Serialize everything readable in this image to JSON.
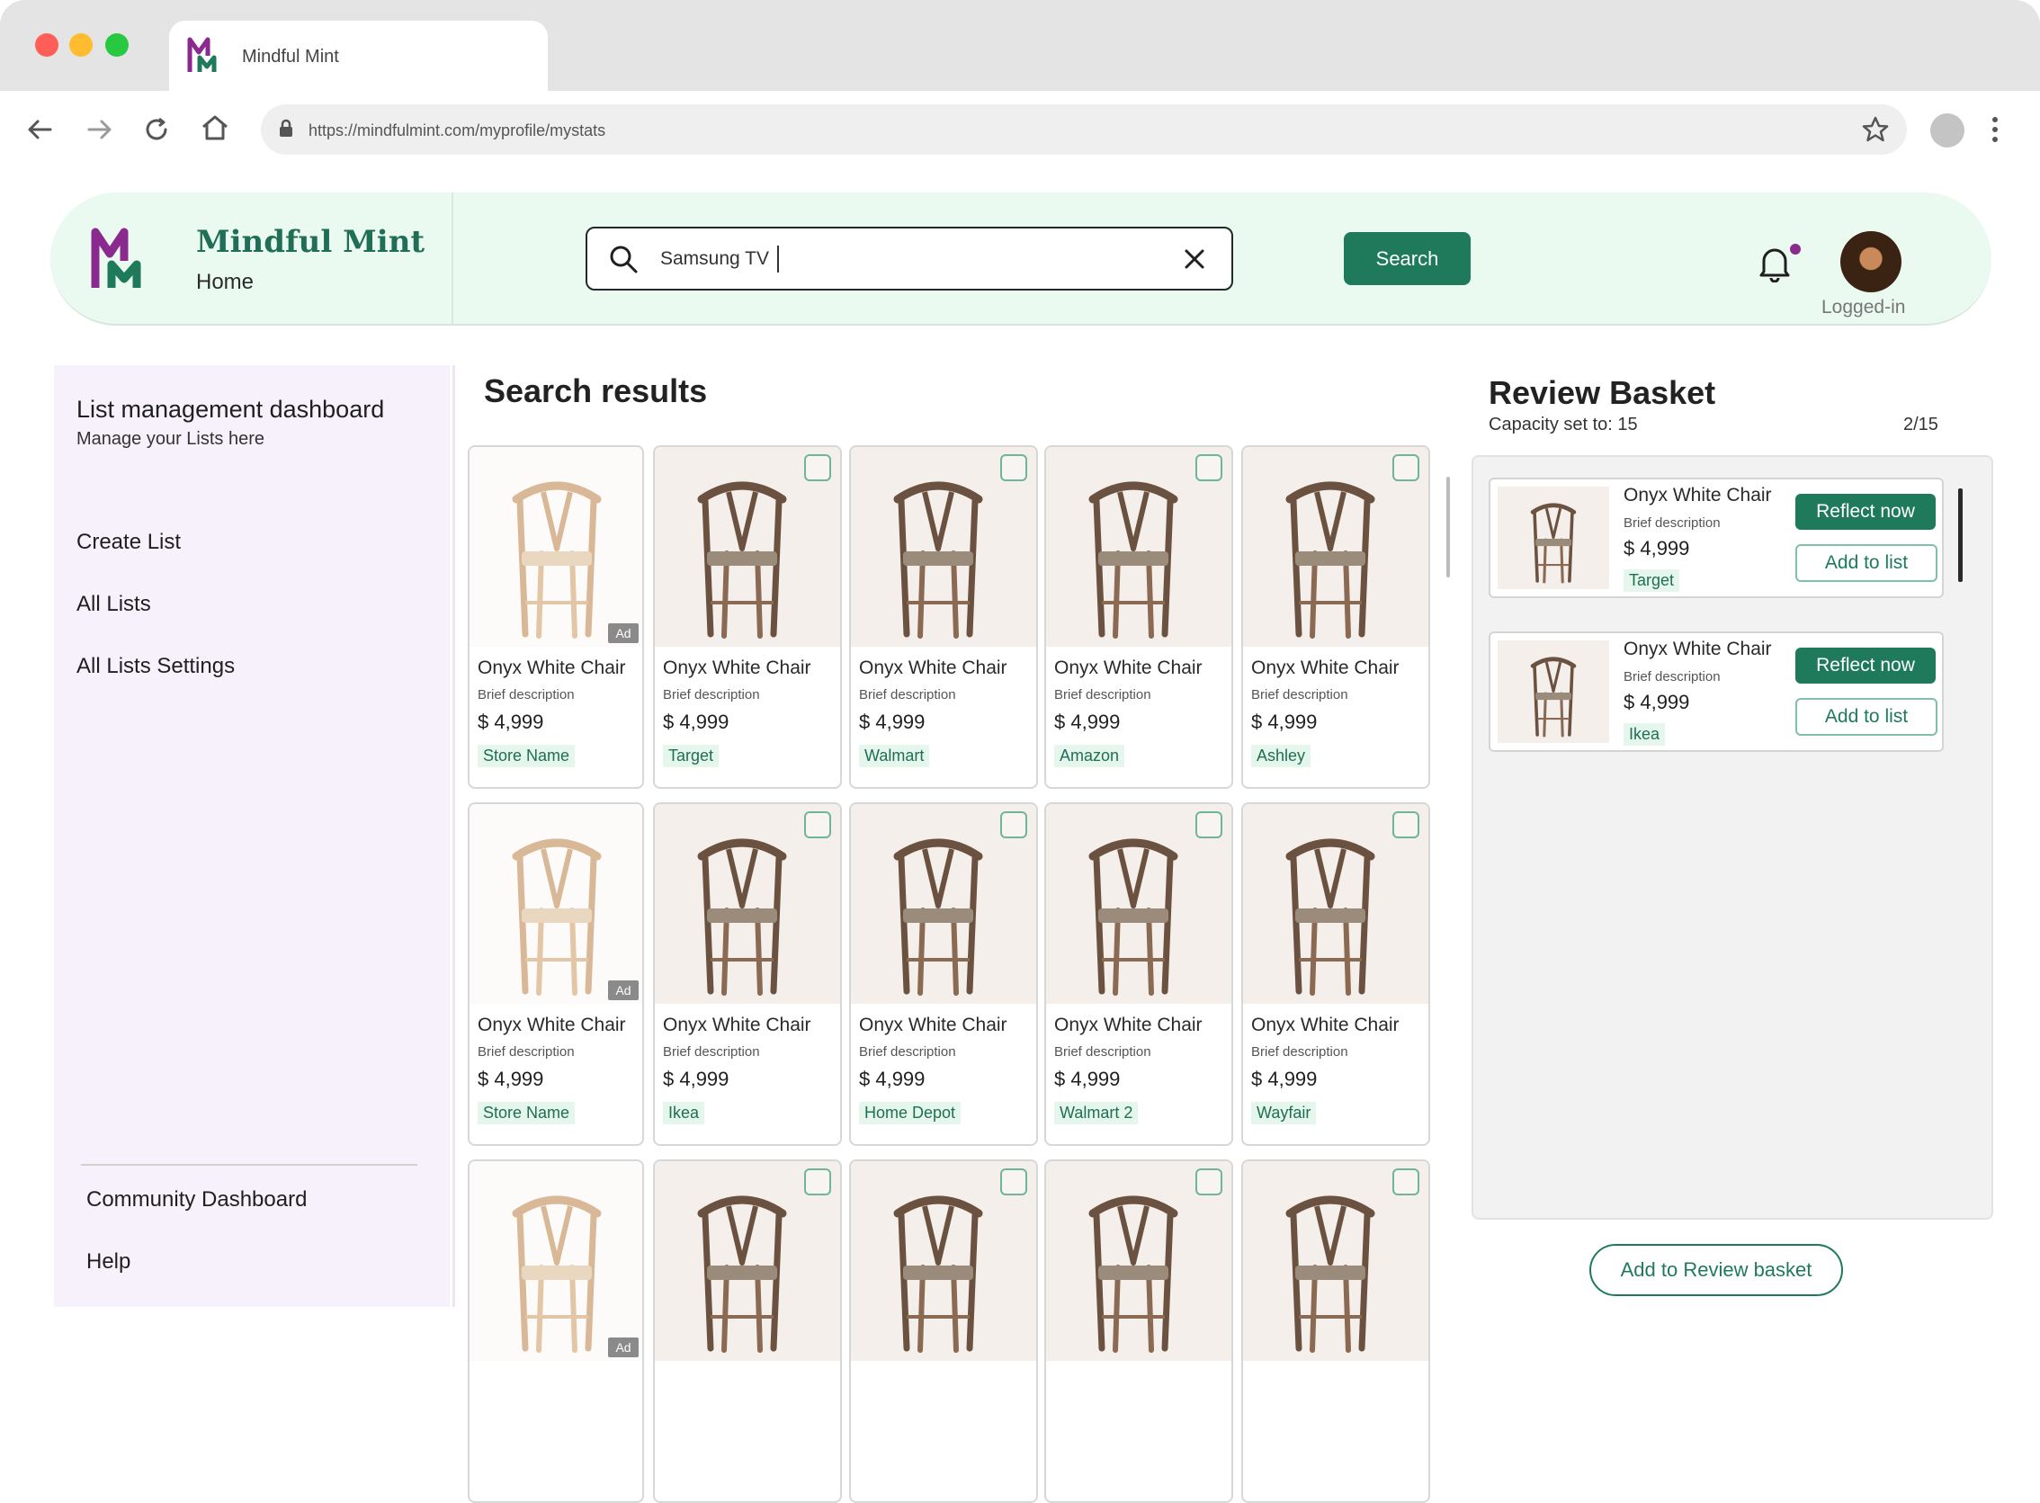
{
  "browser": {
    "tab_title": "Mindful Mint",
    "url": "https://mindfulmint.com/myprofile/mystats"
  },
  "header": {
    "brand_name": "Mindful Mint",
    "brand_sub": "Home",
    "search_value": "Samsung TV",
    "search_button": "Search",
    "user_status": "Logged-in"
  },
  "sidebar": {
    "title": "List management dashboard",
    "subtitle": "Manage your Lists here",
    "items": [
      {
        "label": "Create List"
      },
      {
        "label": "All Lists"
      },
      {
        "label": "All Lists Settings"
      }
    ],
    "footer_items": [
      {
        "label": "Community Dashboard"
      },
      {
        "label": "Help"
      }
    ]
  },
  "results": {
    "title": "Search results",
    "ad_label": "Ad",
    "items": [
      {
        "name": "Onyx White Chair",
        "description": "Brief description",
        "price": "$ 4,999",
        "store": "Store Name",
        "ad": true
      },
      {
        "name": "Onyx White Chair",
        "description": "Brief description",
        "price": "$ 4,999",
        "store": "Target",
        "ad": false
      },
      {
        "name": "Onyx White Chair",
        "description": "Brief description",
        "price": "$ 4,999",
        "store": "Walmart",
        "ad": false
      },
      {
        "name": "Onyx White Chair",
        "description": "Brief description",
        "price": "$ 4,999",
        "store": "Amazon",
        "ad": false
      },
      {
        "name": "Onyx White Chair",
        "description": "Brief description",
        "price": "$ 4,999",
        "store": "Ashley",
        "ad": false
      },
      {
        "name": "Onyx White Chair",
        "description": "Brief description",
        "price": "$ 4,999",
        "store": "Store Name",
        "ad": true
      },
      {
        "name": "Onyx White Chair",
        "description": "Brief description",
        "price": "$ 4,999",
        "store": "Ikea",
        "ad": false
      },
      {
        "name": "Onyx White Chair",
        "description": "Brief description",
        "price": "$ 4,999",
        "store": "Home Depot",
        "ad": false
      },
      {
        "name": "Onyx White Chair",
        "description": "Brief description",
        "price": "$ 4,999",
        "store": "Walmart 2",
        "ad": false
      },
      {
        "name": "Onyx White Chair",
        "description": "Brief description",
        "price": "$ 4,999",
        "store": "Wayfair",
        "ad": false
      },
      {
        "ad": true
      },
      {
        "ad": false
      },
      {
        "ad": false
      },
      {
        "ad": false
      },
      {
        "ad": false
      }
    ]
  },
  "basket": {
    "title": "Review Basket",
    "capacity": "Capacity set to: 15",
    "count": "2/15",
    "reflect_label": "Reflect now",
    "add_label": "Add to list",
    "items": [
      {
        "name": "Onyx White Chair",
        "description": "Brief description",
        "price": "$ 4,999",
        "store": "Target"
      },
      {
        "name": "Onyx White Chair",
        "description": "Brief description",
        "price": "$ 4,999",
        "store": "Ikea"
      }
    ],
    "add_button": "Add to Review basket"
  },
  "colors": {
    "brand_green": "#1f7a5c",
    "brand_purple": "#8a2a8f",
    "header_bg": "#eafaf1",
    "sidebar_bg": "#f7f1fb"
  }
}
